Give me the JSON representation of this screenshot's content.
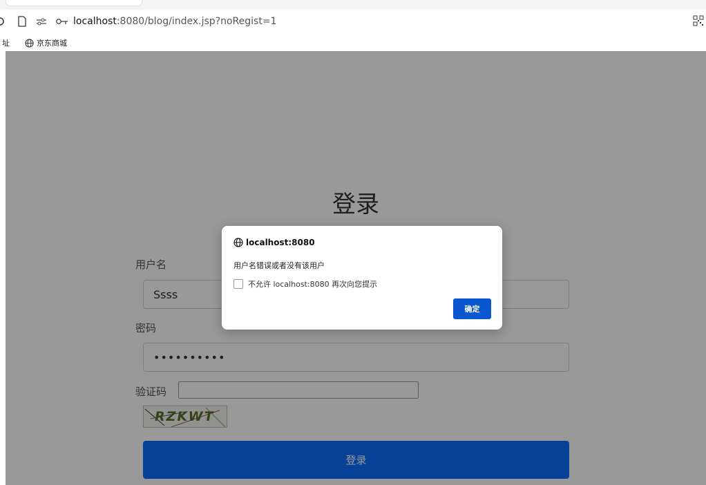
{
  "browser": {
    "url_host": "localhost",
    "url_rest": ":8080/blog/index.jsp?noRegist=1",
    "bookmarks": [
      {
        "label": "址"
      },
      {
        "label": "京东商城"
      }
    ]
  },
  "page": {
    "title": "登录",
    "username_label": "用户名",
    "username_value": "Ssss",
    "password_label": "密码",
    "password_value": "••••••••••",
    "captcha_label": "验证码",
    "captcha_text": "RZKWT",
    "login_button": "登录"
  },
  "dialog": {
    "origin": "localhost:8080",
    "message": "用户名错误或者没有该用户",
    "checkbox_label": "不允许 localhost:8080 再次向您提示",
    "ok_button": "确定"
  },
  "colors": {
    "primary": "#0d6efd",
    "dialog_button": "#0b57d0"
  }
}
